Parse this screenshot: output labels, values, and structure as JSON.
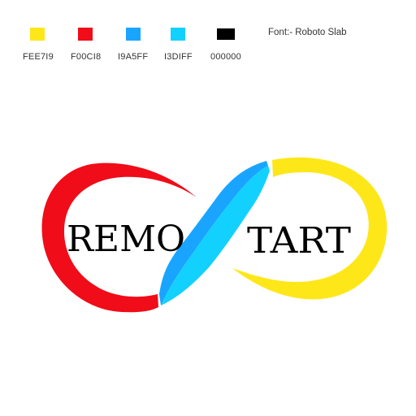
{
  "palette": [
    {
      "name": "yellow",
      "hex": "#FEE719",
      "label": "FEE7I9"
    },
    {
      "name": "red",
      "hex": "#F00C18",
      "label": "F00CI8"
    },
    {
      "name": "blue",
      "hex": "#19A5FF",
      "label": "I9A5FF"
    },
    {
      "name": "cyan",
      "hex": "#13D1FF",
      "label": "I3DIFF"
    },
    {
      "name": "black",
      "hex": "#000000",
      "label": "000000"
    }
  ],
  "font_note": "Font:- Roboto Slab",
  "logo": {
    "left_word": "REMO",
    "right_word": "TART",
    "colors": {
      "left_loop": "#F00C18",
      "right_loop": "#FEE719",
      "band_dark": "#19A5FF",
      "band_light": "#13D1FF",
      "text": "#000000"
    }
  }
}
